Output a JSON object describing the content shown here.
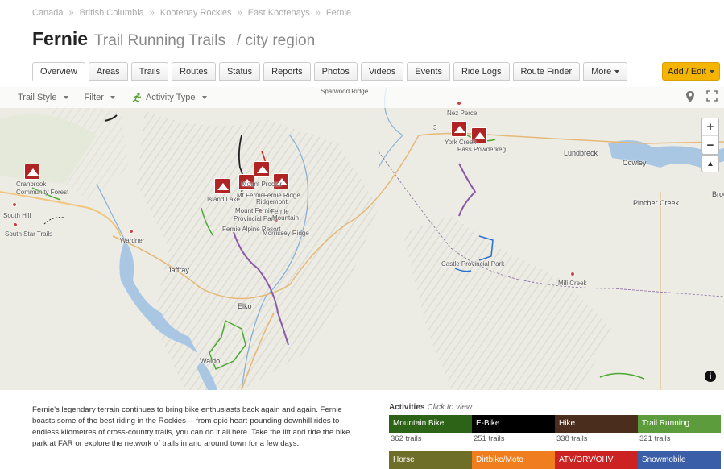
{
  "breadcrumbs": [
    "Canada",
    "British Columbia",
    "Kootenay Rockies",
    "East Kootenays",
    "Fernie"
  ],
  "breadcrumb_sep": "»",
  "title": {
    "main": "Fernie",
    "sub": "Trail Running Trails",
    "region": "/ city region"
  },
  "tabs": [
    {
      "label": "Overview",
      "active": true
    },
    {
      "label": "Areas"
    },
    {
      "label": "Trails"
    },
    {
      "label": "Routes"
    },
    {
      "label": "Status"
    },
    {
      "label": "Reports"
    },
    {
      "label": "Photos"
    },
    {
      "label": "Videos"
    },
    {
      "label": "Events"
    },
    {
      "label": "Ride Logs"
    },
    {
      "label": "Route Finder"
    },
    {
      "label": "More",
      "dropdown": true
    }
  ],
  "add_edit": {
    "label": "Add / Edit",
    "color": "#f4b400"
  },
  "map_toolbar": {
    "trail_style": "Trail Style",
    "filter": "Filter",
    "activity_type": "Activity Type",
    "icons": [
      "location-pin-icon",
      "fullscreen-icon"
    ]
  },
  "map_controls": {
    "zoom_in": "+",
    "zoom_out": "−",
    "compass": "▲",
    "info": "i"
  },
  "map_labels": {
    "sparwood_ridge": "Sparwood Ridge",
    "nez_perce": "Nez Perce",
    "york_creek": "York Creek",
    "pass_powderkeg": "Pass Powderkeg",
    "lundbreck": "Lundbreck",
    "cowley": "Cowley",
    "pincher_creek": "Pincher Creek",
    "broc": "Broc",
    "cranbrook": "Cranbrook",
    "community_forest": "Community Forest",
    "south_hill": "South Hill",
    "south_star": "South Star Trails",
    "wardner": "Wardner",
    "jaffray": "Jaffray",
    "island_lake": "Island Lake",
    "mount_proctor": "Mount Proctor",
    "mt_fernie": "Mt Fernie",
    "fernie_ridge": "Fernie Ridge",
    "ridgemont": "Ridgemont",
    "mount_fernie": "Mount Fernie",
    "provincial_park": "Provincial Park",
    "fernie": "Fernie",
    "mountain": "Mountain",
    "fernie_alpine": "Fernie Alpine Resort",
    "morrissey_ridge": "Morrissey Ridge",
    "castle_park": "Castle Provincial Park",
    "mill_creek": "Mill Creek",
    "elko": "Elko",
    "waldo": "Waldo",
    "highway_3": "3"
  },
  "description": "Fernie's legendary terrain continues to bring bike enthusiasts back again and again. Fernie boasts some of the best riding in the Rockies— from epic heart-pounding downhill rides to endless kilometres of cross-country trails, you can do it all here. Take the lift and ride the bike park at FAR or explore the network of trails in and around town for a few days.",
  "activities": {
    "heading": "Activities",
    "hint": "Click to view",
    "items": [
      {
        "label": "Mountain Bike",
        "count": "362 trails",
        "color": "#2c6316"
      },
      {
        "label": "E-Bike",
        "count": "251 trails",
        "color": "#000000"
      },
      {
        "label": "Hike",
        "count": "338 trails",
        "color": "#4a2d1d"
      },
      {
        "label": "Trail Running",
        "count": "321 trails",
        "color": "#5c9c3c"
      },
      {
        "label": "Horse",
        "count": "",
        "color": "#6e6e29"
      },
      {
        "label": "Dirtbike/Moto",
        "count": "",
        "color": "#f07e1e"
      },
      {
        "label": "ATV/ORV/OHV",
        "count": "",
        "color": "#cc2222"
      },
      {
        "label": "Snowmobile",
        "count": "",
        "color": "#3b5ea8"
      }
    ]
  }
}
